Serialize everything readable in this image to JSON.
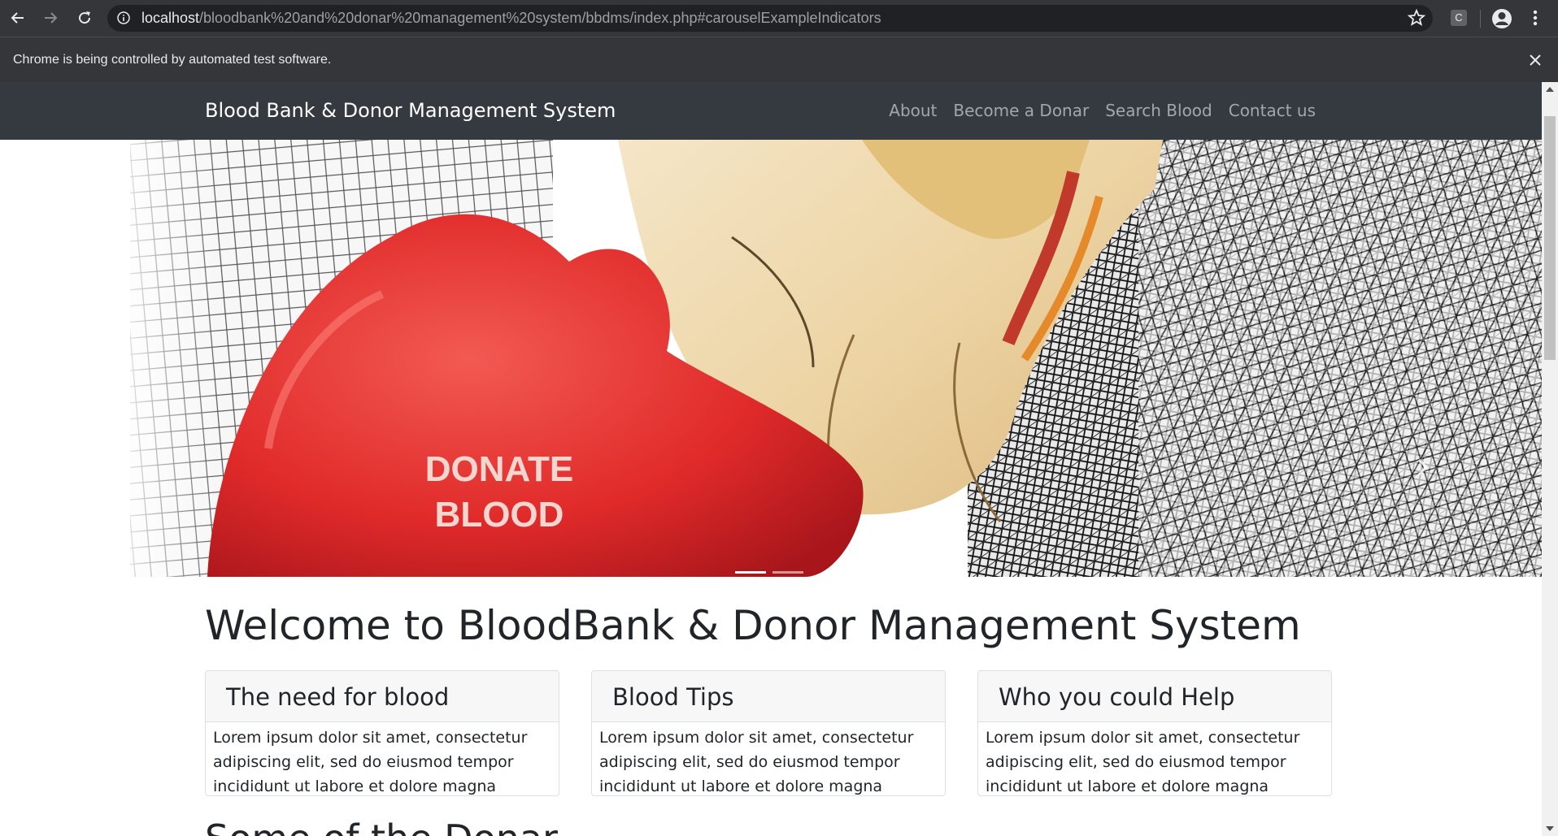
{
  "browser": {
    "url_host": "localhost",
    "url_path": "/bloodbank%20and%20donar%20management%20system/bbdms/index.php#carouselExampleIndicators",
    "profile_initial": "C",
    "infobar_message": "Chrome is being controlled by automated test software."
  },
  "site": {
    "brand": "Blood Bank & Donor Management System",
    "nav": [
      "About",
      "Become a Donar",
      "Search Blood",
      "Contact us"
    ]
  },
  "carousel": {
    "slide_text_line1": "DONATE",
    "slide_text_line2": "BLOOD",
    "indicator_count": 2,
    "active_indicator": 0
  },
  "main": {
    "welcome": "Welcome to BloodBank & Donor Management System",
    "cards": [
      {
        "title": "The need for blood",
        "body": "Lorem ipsum dolor sit amet, consectetur adipiscing elit, sed do eiusmod tempor incididunt ut labore et dolore magna aliqua."
      },
      {
        "title": "Blood Tips",
        "body": "Lorem ipsum dolor sit amet, consectetur adipiscing elit, sed do eiusmod tempor incididunt ut labore et dolore magna aliqua."
      },
      {
        "title": "Who you could Help",
        "body": "Lorem ipsum dolor sit amet, consectetur adipiscing elit, sed do eiusmod tempor incididunt ut labore et dolore magna aliqua."
      }
    ],
    "next_heading": "Some of the Donar"
  },
  "colors": {
    "chrome_dark": "#35363a",
    "omnibox": "#202124",
    "site_nav": "#343a40",
    "heart_red": "#e02a2a"
  }
}
